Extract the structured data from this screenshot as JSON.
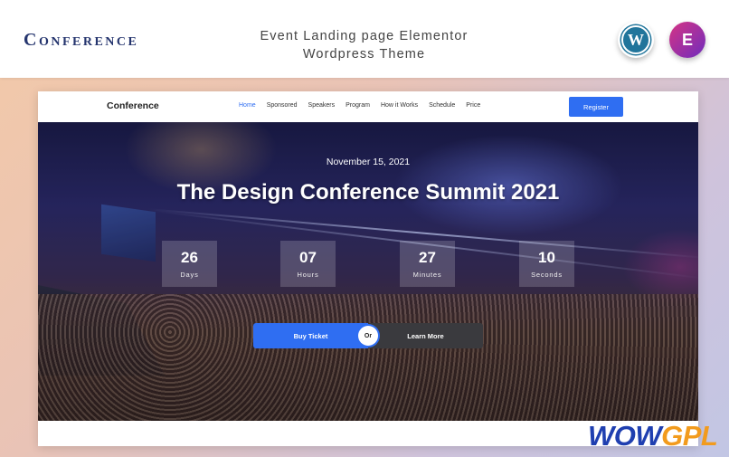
{
  "banner": {
    "brand": "Conference",
    "description_line1": "Event Landing page Elementor",
    "description_line2": "Wordpress Theme",
    "badges": [
      {
        "name": "wordpress-icon",
        "glyph": "W",
        "color": "#21759b"
      },
      {
        "name": "elementor-icon",
        "glyph": "E",
        "color": "#b72c8c"
      }
    ]
  },
  "site": {
    "logo": "Conference",
    "nav": [
      "Home",
      "Sponsored",
      "Speakers",
      "Program",
      "How it Works",
      "Schedule",
      "Price"
    ],
    "nav_active": "Home",
    "register_label": "Register",
    "hero": {
      "date": "November 15, 2021",
      "title": "The Design Conference Summit 2021",
      "countdown": [
        {
          "value": "26",
          "label": "Days"
        },
        {
          "value": "07",
          "label": "Hours"
        },
        {
          "value": "27",
          "label": "Minutes"
        },
        {
          "value": "10",
          "label": "Seconds"
        }
      ],
      "buy_label": "Buy Ticket",
      "or_label": "Or",
      "learn_label": "Learn More"
    }
  },
  "watermark": {
    "part1": "WOW",
    "part2": "GPL"
  },
  "colors": {
    "accent": "#2f6ef2",
    "brand": "#25356e",
    "watermark_blue": "#1f3fb0",
    "watermark_orange": "#f29b1d"
  }
}
